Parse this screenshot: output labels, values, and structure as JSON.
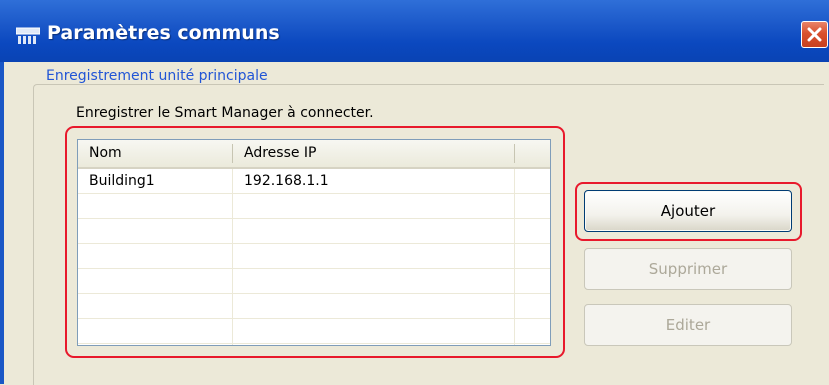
{
  "window": {
    "title": "Paramètres communs"
  },
  "group": {
    "legend": "Enregistrement unité principale",
    "instruction": "Enregistrer le Smart Manager à connecter."
  },
  "table": {
    "columns": [
      "Nom",
      "Adresse IP"
    ],
    "rows": [
      {
        "name": "Building1",
        "ip": "192.168.1.1"
      },
      {
        "name": "",
        "ip": ""
      },
      {
        "name": "",
        "ip": ""
      },
      {
        "name": "",
        "ip": ""
      },
      {
        "name": "",
        "ip": ""
      },
      {
        "name": "",
        "ip": ""
      },
      {
        "name": "",
        "ip": ""
      }
    ]
  },
  "buttons": {
    "add": "Ajouter",
    "delete": "Supprimer",
    "edit": "Editer"
  },
  "colors": {
    "titlebar": "#0a48bf",
    "highlight": "#e8192c",
    "legend_text": "#2155d6",
    "disabled_text": "#aca899"
  },
  "icons": {
    "title": "settings-panel-icon",
    "close": "close-icon"
  }
}
